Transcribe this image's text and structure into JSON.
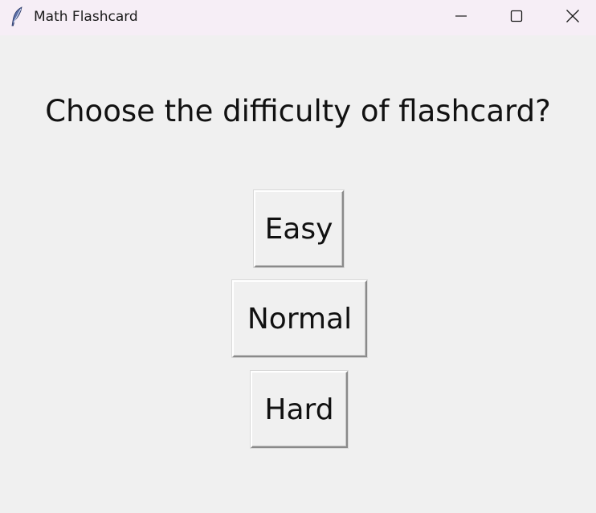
{
  "window": {
    "title": "Math Flashcard",
    "icon": "feather-icon",
    "controls": [
      "minimize-icon",
      "maximize-icon",
      "close-icon"
    ]
  },
  "main": {
    "question": "Choose the difficulty of flashcard?",
    "options": [
      {
        "label": "Easy"
      },
      {
        "label": "Normal"
      },
      {
        "label": "Hard"
      }
    ]
  },
  "colors": {
    "background": "#f0f0f0",
    "titlebar": "#f6eef6",
    "text": "#111111"
  }
}
